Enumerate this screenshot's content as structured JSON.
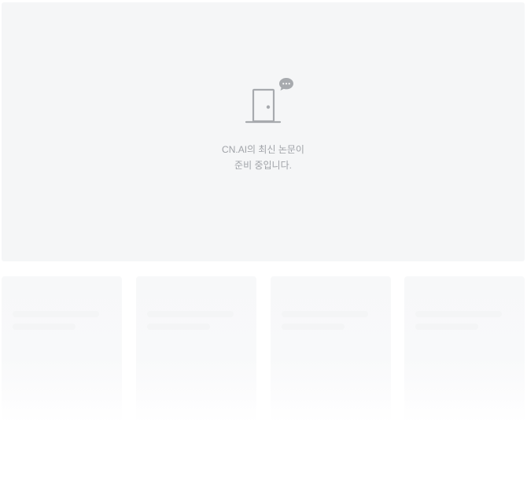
{
  "empty_state": {
    "icon": "door-icon",
    "badge_icon": "chat-bubble-icon",
    "line1": "CN.AI의 최신 논문이",
    "line2": "준비 중입니다."
  },
  "placeholders": {
    "count": 4,
    "state": "loading"
  },
  "colors": {
    "hero_background": "#f5f6f7",
    "icon_gray": "#a7aaae",
    "text_gray": "#a0a3a8",
    "skeleton": "#f7f8f9"
  }
}
